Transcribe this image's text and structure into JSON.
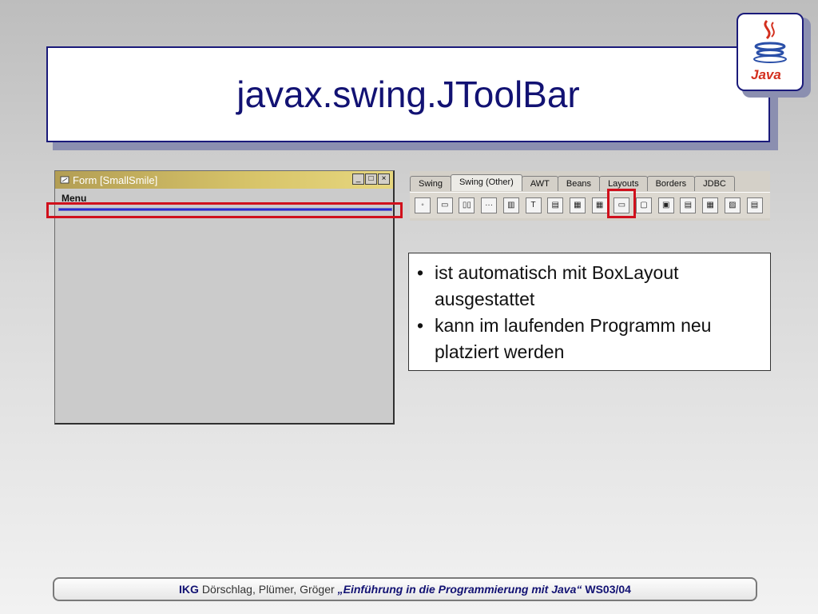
{
  "slide": {
    "title": "javax.swing.JToolBar",
    "logo_text": "Java"
  },
  "form_window": {
    "title": "Form [SmallSmile]",
    "menu_label": "Menu",
    "buttons": [
      "_",
      "□",
      "×"
    ]
  },
  "palette": {
    "tabs": [
      "Swing",
      "Swing (Other)",
      "AWT",
      "Beans",
      "Layouts",
      "Borders",
      "JDBC"
    ],
    "active_tab": "Swing (Other)",
    "tool_icons": [
      "bean-icon",
      "separator-icon",
      "split-icon",
      "dots-icon",
      "layers-icon",
      "text-icon",
      "textfield-icon",
      "toolbar-icon",
      "table-icon",
      "jtoolbar-icon",
      "window-icon",
      "frame-icon",
      "internal-frame-icon",
      "panel-icon",
      "image-icon",
      "dialog-icon"
    ],
    "tool_glyphs": [
      "◦",
      "▭",
      "▯▯",
      "···",
      "▥",
      "T",
      "▤",
      "▦",
      "▦",
      "▭",
      "▢",
      "▣",
      "▤",
      "▦",
      "▨",
      "▤"
    ]
  },
  "bullets": [
    "ist automatisch mit BoxLayout ausgestattet",
    "kann im laufenden Programm neu platziert werden"
  ],
  "footer": {
    "org": "IKG",
    "authors": "Dörschlag, Plümer, Gröger",
    "course": "„Einführung in die Programmierung mit Java“",
    "semester": "WS03/04"
  },
  "colors": {
    "title": "#121273",
    "highlight": "#d0101c"
  }
}
